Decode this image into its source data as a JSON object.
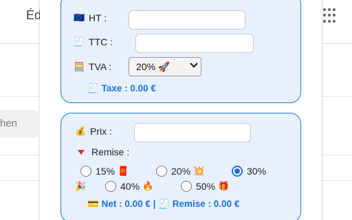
{
  "background": {
    "title": "Éd",
    "search_placeholder": "hen",
    "apps_icon": "apps-grid-icon"
  },
  "calc": {
    "ht_icon": "🇪🇺",
    "ht_label": "HT :",
    "ht_value": "",
    "ttc_icon": "🧾",
    "ttc_label": "TTC :",
    "ttc_value": "",
    "tva_icon": "🧮",
    "tva_label": "TVA :",
    "tva_selected": "20% 🚀",
    "taxe_icon": "🧾",
    "taxe_text": "Taxe : 0.00 €"
  },
  "discount": {
    "prix_icon": "💰",
    "prix_label": "Prix :",
    "prix_value": "",
    "remise_label": "Remise :",
    "options": [
      {
        "label": "15%",
        "emoji": "🧧",
        "checked": false
      },
      {
        "label": "20%",
        "emoji": "💥",
        "checked": false
      },
      {
        "label": "30%",
        "emoji": "🎉",
        "checked": true
      },
      {
        "label": "40%",
        "emoji": "🔥",
        "checked": false
      },
      {
        "label": "50%",
        "emoji": "🎁",
        "checked": false
      }
    ],
    "net_icon": "💳",
    "net_text": "Net : 0.00 €",
    "separator": "|",
    "remise_icon": "🧾",
    "remise_text": "Remise : 0.00 €"
  },
  "colors": {
    "accent": "#1a73e8",
    "card_bg": "#e8f0fe"
  }
}
